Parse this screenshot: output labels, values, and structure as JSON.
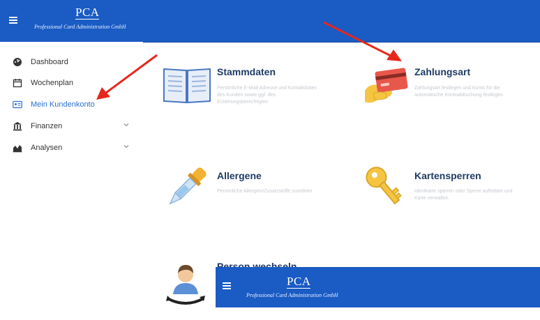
{
  "header": {
    "logo_text": "PCA",
    "logo_subtitle": "Professional Card Administration GmbH"
  },
  "sidebar": {
    "items": [
      {
        "label": "Dashboard",
        "icon": "dashboard-icon"
      },
      {
        "label": "Wochenplan",
        "icon": "calendar-icon"
      },
      {
        "label": "Mein Kundenkonto",
        "icon": "id-card-icon",
        "active": true
      },
      {
        "label": "Finanzen",
        "icon": "bank-icon",
        "expandable": true
      },
      {
        "label": "Analysen",
        "icon": "chart-icon",
        "expandable": true
      }
    ]
  },
  "cards": [
    {
      "title": "Stammdaten",
      "description": "Persönliche E-Mail-Adresse und Kontaktdaten des Kunden sowie ggf. des Erziehungsberechtigten",
      "icon": "book-icon"
    },
    {
      "title": "Zahlungsart",
      "description": "Zahlungsart festlegen und Konto für die automatische Kontoabbuchung festlegen",
      "icon": "credit-card-icon"
    },
    {
      "title": "Allergene",
      "description": "Persönliche Allergien/Zusatzstoffe zuordnen",
      "icon": "dropper-icon"
    },
    {
      "title": "Kartensperren",
      "description": "Identkarte sperren oder Sperre aufheben und Karte verwalten",
      "icon": "key-icon"
    },
    {
      "title": "Person wechseln",
      "description": "",
      "icon": "person-switch-icon"
    }
  ],
  "overlay_header": {
    "logo_text": "PCA",
    "logo_subtitle": "Professional Card Administration GmbH"
  },
  "colors": {
    "header_bg": "#1a5bc4",
    "active_link": "#2d6fd0",
    "card_title": "#1f3b64",
    "annotation_arrow": "#e5281c"
  }
}
